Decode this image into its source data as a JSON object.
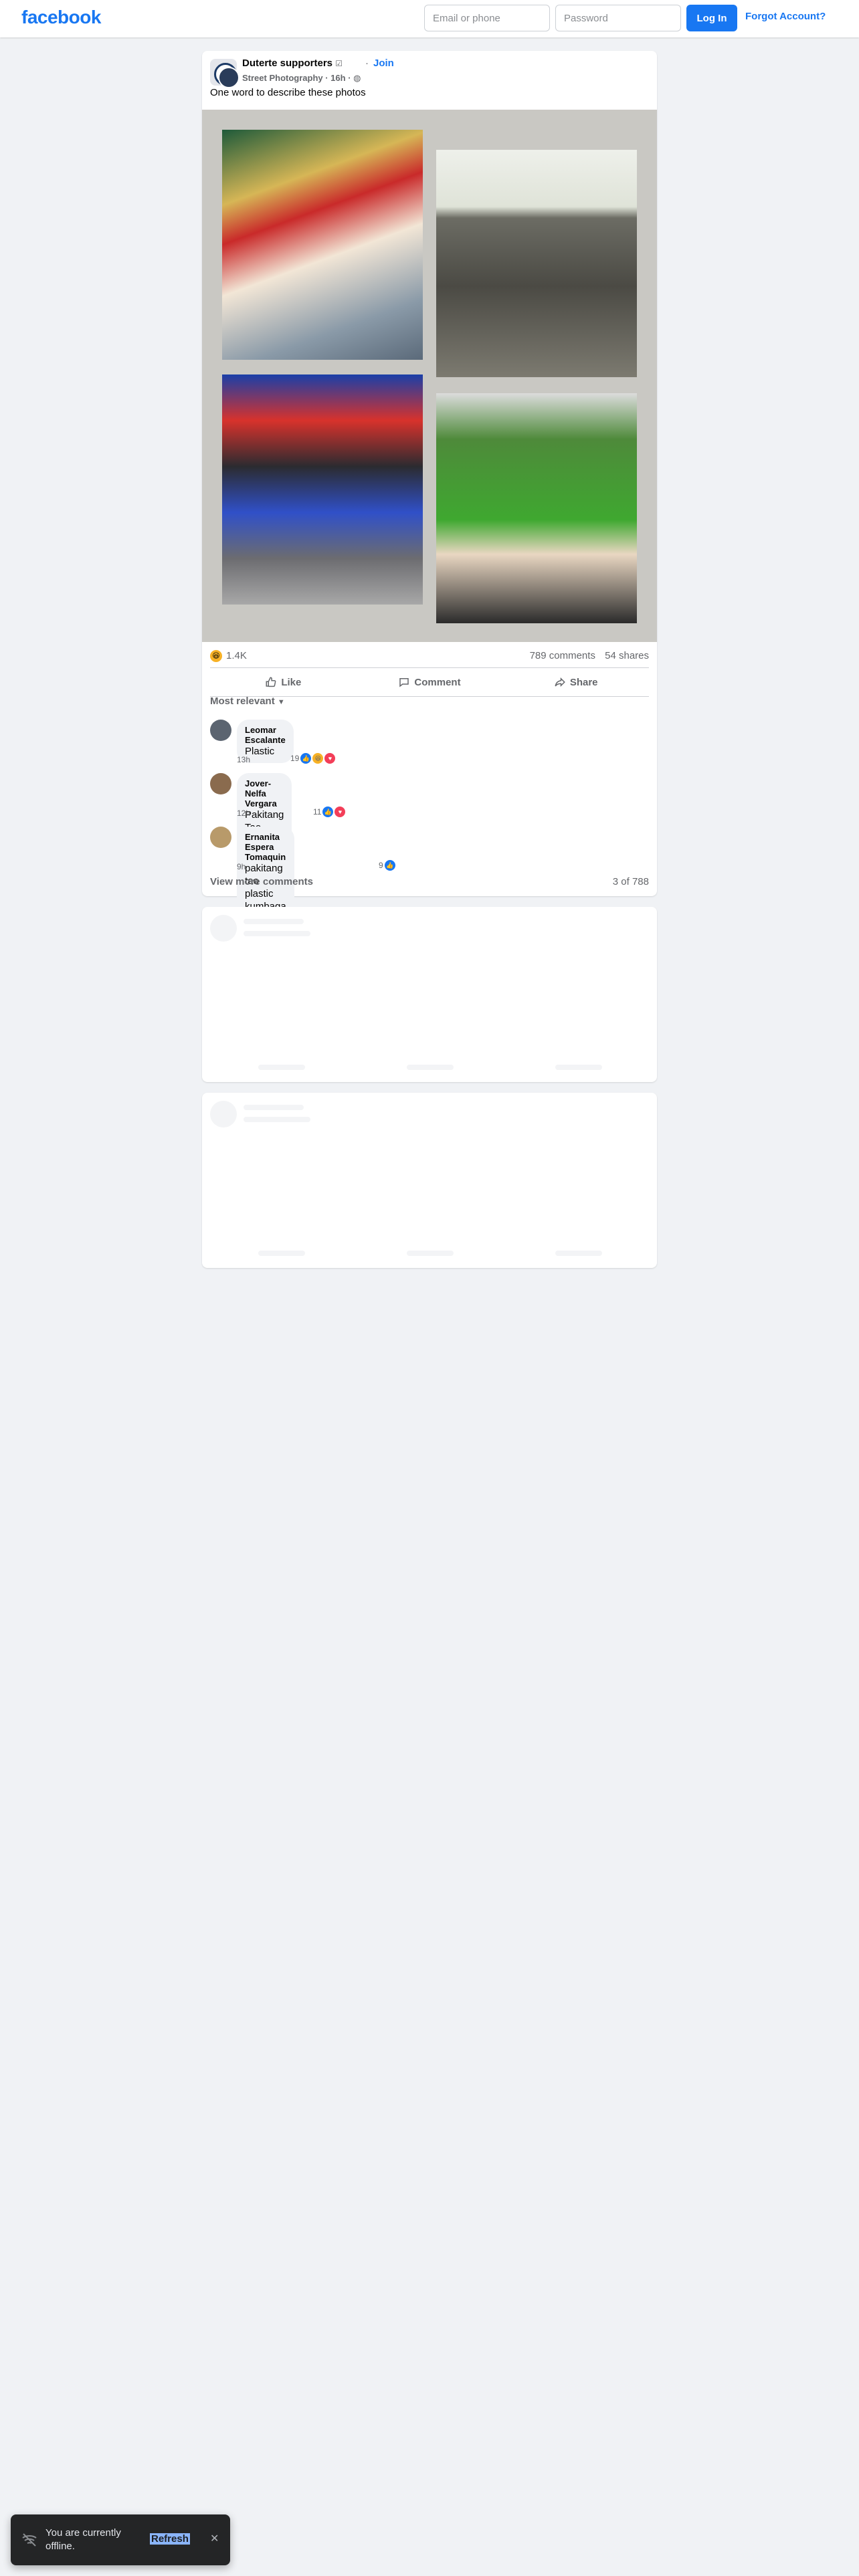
{
  "nav": {
    "logo": "facebook",
    "email_placeholder": "Email or phone",
    "password_placeholder": "Password",
    "login_label": "Log In",
    "forgot_label": "Forgot Account?"
  },
  "post": {
    "group_name": "Duterte supporters",
    "join_dot": "·",
    "join_label": "Join",
    "meta": "Street Photography · 16h · ",
    "text": "One word to describe these photos",
    "reaction_count": "1.4K",
    "comments_count": "789 comments",
    "shares_count": "54 shares",
    "like_label": "Like",
    "comment_label": "Comment",
    "share_label": "Share",
    "sort_label": "Most relevant",
    "comments": [
      {
        "name": "Leomar Escalante",
        "text": "Plastic",
        "time": "13h",
        "reacts": "19"
      },
      {
        "name": "Jover-Nelfa Vergara",
        "text": "Pakitang Tao photos",
        "time": "12h",
        "reacts": "11"
      },
      {
        "name": "Ernanita Espera Tomaquin",
        "text": "pakitang tao plastic kumbaga",
        "time": "9h",
        "reacts": "9"
      }
    ],
    "view_more": "View more comments",
    "count_of": "3 of 788"
  },
  "toast": {
    "text": "You are currently offline.",
    "refresh": "Refresh"
  },
  "colors": {
    "brand": "#1877f2",
    "background": "#f0f2f5"
  }
}
